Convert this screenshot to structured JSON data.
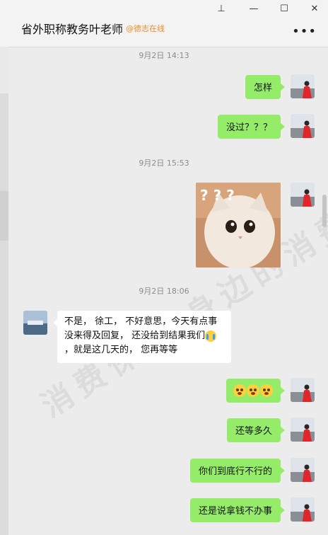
{
  "window": {
    "pin_glyph": "⊥",
    "minimize_glyph": "—",
    "maximize_glyph": "☐",
    "close_glyph": "✕"
  },
  "header": {
    "title": "省外职称教务叶老师",
    "subtitle": "@德志在线",
    "more_glyph": "•••"
  },
  "messages": {
    "ts1": "9月2日 14:13",
    "m1": "怎样",
    "m2": "没过？？？",
    "ts2": "9月2日 15:53",
    "ts3": "9月2日 18:06",
    "m4_part1": "不是， 徐工， 不好意思，今天有点事没来得及回复， 还没给到结果我们",
    "m4_part2": "，就是这几天的， 您再等等",
    "m6": "还等多久",
    "m7": "你们到底行不行的",
    "m8": "还是说拿钱不办事"
  },
  "image_message": {
    "overlay": "? ? ?"
  },
  "watermark": {
    "text": "消费保 您身边的消费"
  },
  "colors": {
    "my_bubble": "#95ec69",
    "their_bubble": "#ffffff",
    "subtitle": "#f08a24",
    "background": "#ececec"
  },
  "icons": [
    "pin-icon",
    "minimize-icon",
    "maximize-icon",
    "close-icon",
    "more-icon",
    "crying-emoji",
    "flushed-emoji"
  ]
}
